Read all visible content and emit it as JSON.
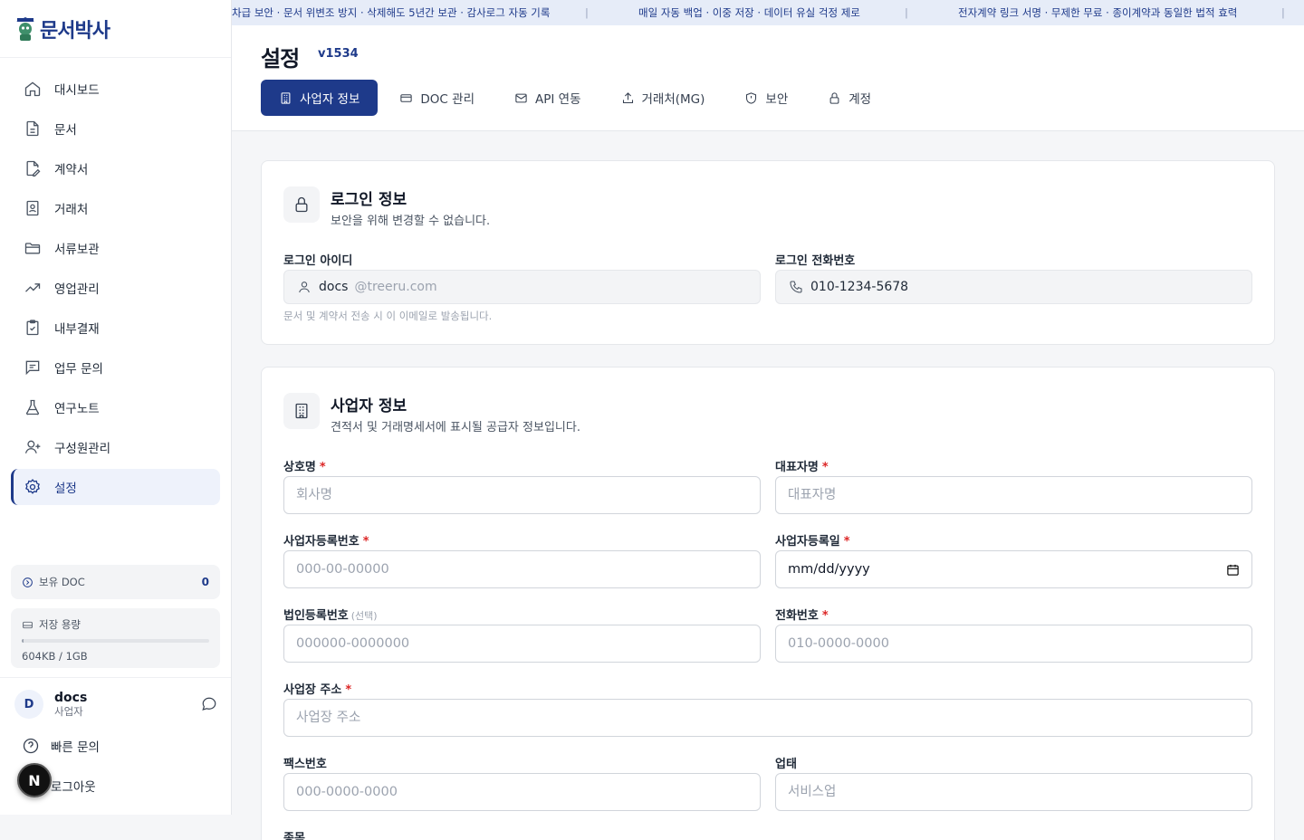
{
  "app": {
    "logo_text": "문서박사"
  },
  "sidebar": {
    "items": [
      {
        "label": "대시보드",
        "icon": "home-icon"
      },
      {
        "label": "문서",
        "icon": "document-icon"
      },
      {
        "label": "계약서",
        "icon": "contract-edit-icon"
      },
      {
        "label": "거래처",
        "icon": "contact-card-icon"
      },
      {
        "label": "서류보관",
        "icon": "folder-icon"
      },
      {
        "label": "영업관리",
        "icon": "trend-up-icon"
      },
      {
        "label": "내부결재",
        "icon": "clipboard-check-icon"
      },
      {
        "label": "업무 문의",
        "icon": "message-square-icon"
      },
      {
        "label": "연구노트",
        "icon": "flask-icon"
      },
      {
        "label": "구성원관리",
        "icon": "user-plus-icon"
      },
      {
        "label": "설정",
        "icon": "settings-icon"
      }
    ],
    "doc_label": "보유 DOC",
    "doc_count": "0",
    "storage_label": "저장 용량",
    "storage_text": "604KB / 1GB",
    "storage_fraction": 0.0006,
    "user": {
      "initial": "D",
      "name": "docs",
      "role": "사업자"
    },
    "quick_inquiry": "빠른 문의",
    "logout": "로그아웃"
  },
  "ticker": {
    "messages": [
      "차급 보안 · 문서 위변조 방지 · 삭제해도 5년간 보관 · 감사로그 자동 기록",
      "매일 자동 백업 · 이중 저장 · 데이터 유실 걱정 제로",
      "전자계약 링크 서명 · 무제한 무료 · 종이계약과 동일한 법적 효력"
    ],
    "separator": "|"
  },
  "header": {
    "title": "설정",
    "version": "v1534",
    "tabs": [
      {
        "label": "사업자 정보",
        "icon": "building-icon",
        "active": true
      },
      {
        "label": "DOC 관리",
        "icon": "credit-card-icon",
        "active": false
      },
      {
        "label": "API 연동",
        "icon": "mail-icon",
        "active": false
      },
      {
        "label": "거래처(MG)",
        "icon": "upload-icon",
        "active": false
      },
      {
        "label": "보안",
        "icon": "shield-icon",
        "active": false
      },
      {
        "label": "계정",
        "icon": "lock-icon",
        "active": false
      }
    ]
  },
  "login_card": {
    "title": "로그인 정보",
    "subtitle": "보안을 위해 변경할 수 없습니다.",
    "id_label": "로그인 아이디",
    "id_value": "docs",
    "id_domain": "@treeru.com",
    "phone_label": "로그인 전화번호",
    "phone_value": "010-1234-5678",
    "helper": "문서 및 계약서 전송 시 이 이메일로 발송됩니다."
  },
  "business_card": {
    "title": "사업자 정보",
    "subtitle": "견적서 및 거래명세서에 표시될 공급자 정보입니다.",
    "required_mark": "*",
    "fields": {
      "company_name": {
        "label": "상호명",
        "placeholder": "회사명"
      },
      "ceo_name": {
        "label": "대표자명",
        "placeholder": "대표자명"
      },
      "biz_reg_no": {
        "label": "사업자등록번호",
        "placeholder": "000-00-00000"
      },
      "biz_reg_date": {
        "label": "사업자등록일",
        "value": "mm/dd/yyyy"
      },
      "corp_reg_no": {
        "label": "법인등록번호",
        "optional": "(선택)",
        "placeholder": "000000-0000000"
      },
      "phone": {
        "label": "전화번호",
        "placeholder": "010-0000-0000"
      },
      "address": {
        "label": "사업장 주소",
        "placeholder": "사업장 주소"
      },
      "fax": {
        "label": "팩스번호",
        "placeholder": "000-0000-0000"
      },
      "biz_type": {
        "label": "업태",
        "placeholder": "서비스업"
      },
      "biz_item": {
        "label": "종목"
      }
    }
  },
  "colors": {
    "brand": "#1e3a8a",
    "required": "#dc2626",
    "ticker_bg": "#e6ecf8"
  }
}
